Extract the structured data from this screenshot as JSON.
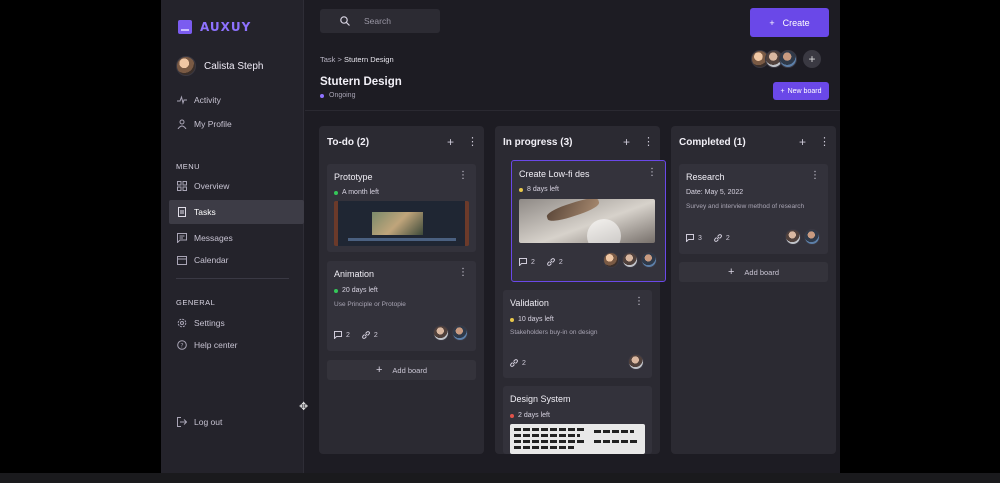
{
  "colors": {
    "accent": "#6a48e8",
    "green": "#34c759",
    "yellow": "#e8c74a",
    "red": "#e0524a",
    "purple": "#8e72ff"
  },
  "logo": {
    "text": "AUXUY"
  },
  "user": {
    "name": "Calista Steph"
  },
  "nav_top": [
    {
      "label": "Activity",
      "icon": "activity-icon"
    },
    {
      "label": "My Profile",
      "icon": "user-icon"
    }
  ],
  "menu": {
    "title": "MENU",
    "items": [
      {
        "label": "Overview",
        "icon": "grid-icon"
      },
      {
        "label": "Tasks",
        "icon": "document-icon",
        "active": true
      },
      {
        "label": "Messages",
        "icon": "message-icon"
      },
      {
        "label": "Calendar",
        "icon": "calendar-icon"
      }
    ]
  },
  "general": {
    "title": "GENERAL",
    "items": [
      {
        "label": "Settings",
        "icon": "gear-icon"
      },
      {
        "label": "Help center",
        "icon": "help-icon"
      }
    ]
  },
  "logout": {
    "label": "Log out",
    "icon": "logout-icon"
  },
  "header": {
    "search_placeholder": "Search",
    "create_label": "Create",
    "breadcrumb_root": "Task",
    "breadcrumb_sep": ">",
    "breadcrumb_current": "Stutern Design",
    "title": "Stutern Design",
    "status": "Ongoing",
    "new_board_label": "New board"
  },
  "columns": [
    {
      "title": "To-do (2)",
      "cards": [
        {
          "title": "Prototype",
          "due": "A month left",
          "due_color": "green",
          "thumb": "video"
        },
        {
          "title": "Animation",
          "due": "20 days left",
          "due_color": "green",
          "desc": "Use Principle or Protopie",
          "comments": "2",
          "links": "2"
        }
      ],
      "add_label": "Add board"
    },
    {
      "title": "In progress (3)",
      "cards": [
        {
          "title": "Create Low-fi des",
          "due": "8 days left",
          "due_color": "yellow",
          "thumb": "sketch",
          "comments": "2",
          "links": "2"
        },
        {
          "title": "Validation",
          "due": "10 days left",
          "due_color": "yellow",
          "desc": "Stakeholders buy-in on design",
          "links": "2"
        },
        {
          "title": "Design System",
          "due": "2 days left",
          "due_color": "red",
          "thumb": "wireframe"
        }
      ]
    },
    {
      "title": "Completed (1)",
      "cards": [
        {
          "title": "Research",
          "date": "Date: May 5, 2022",
          "desc": "Survey and interview method of research",
          "comments": "3",
          "links": "2"
        }
      ],
      "add_label": "Add board"
    }
  ]
}
